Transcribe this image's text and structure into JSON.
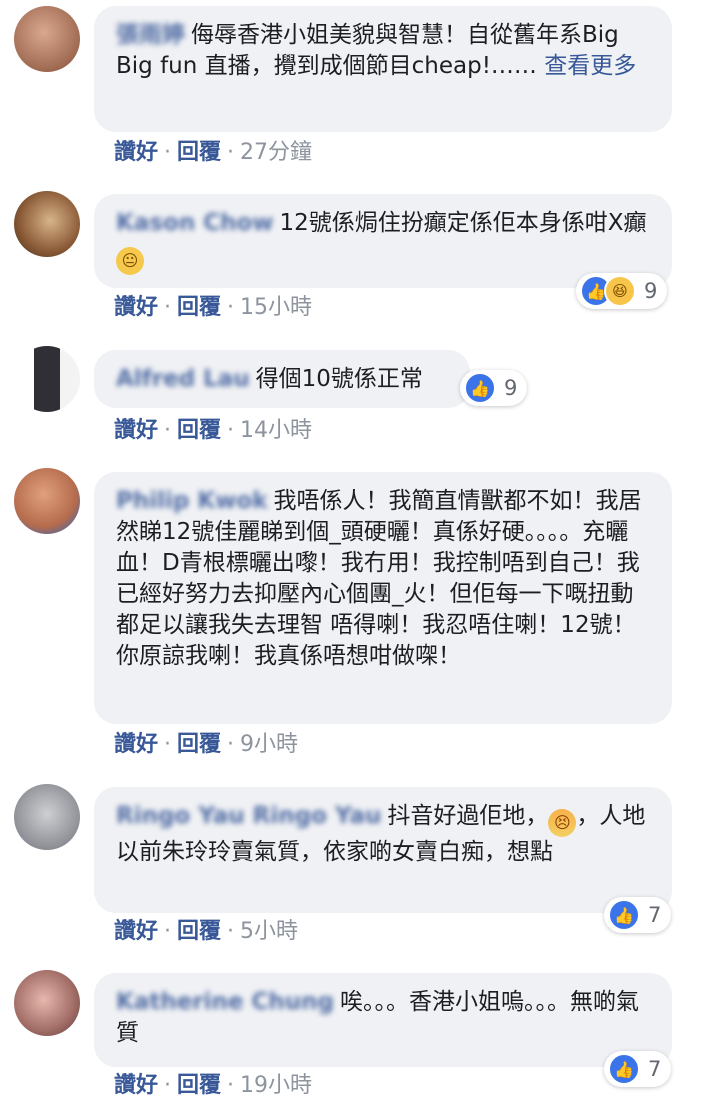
{
  "comments": [
    {
      "author": "張雨婷",
      "text": "侮辱香港小姐美貌與智慧！自從舊年系Big Big fun 直播，攪到成個節目cheap!……",
      "more": "查看更多",
      "like": "讚好",
      "reply": "回覆",
      "time": "27分鐘"
    },
    {
      "author": "Kason Chow",
      "text": "12號係焗住扮癲定係佢本身係咁X癲",
      "emoji": "neutral-face-icon",
      "like": "讚好",
      "reply": "回覆",
      "time": "15小時",
      "reactions": "9"
    },
    {
      "author": "Alfred Lau",
      "text": "得個10號係正常",
      "like": "讚好",
      "reply": "回覆",
      "time": "14小時",
      "reactions": "9"
    },
    {
      "author": "Philip Kwok",
      "text": "我唔係人！我簡直情獸都不如！我居然睇12號佳麗睇到個_頭硬曬！真係好硬。。。。充曬血！D青根標曬出嚟！我冇用！我控制唔到自己！我已經好努力去抑壓內心個團_火！但佢每一下嘅扭動 都足以讓我失去理智 唔得喇！我忍唔住喇！12號！你原諒我喇！我真係唔想咁做㗎！",
      "like": "讚好",
      "reply": "回覆",
      "time": "9小時"
    },
    {
      "author": "Ringo Yau Ringo Yau",
      "text1": "抖音好過佢地，",
      "emoji": "angry-face-icon",
      "text2": "，人地以前朱玲玲賣氣質，依家啲女賣白痴，想點",
      "like": "讚好",
      "reply": "回覆",
      "time": "5小時",
      "reactions": "7"
    },
    {
      "author": "Katherine Chung",
      "text": "唉。。。香港小姐嗚。。。無啲氣質",
      "like": "讚好",
      "reply": "回覆",
      "time": "19小時",
      "reactions": "7"
    }
  ],
  "colors": {
    "link": "#385898",
    "bubble": "#eff1f4",
    "like_blue": "#3b74e8",
    "meta": "#8d949e"
  }
}
